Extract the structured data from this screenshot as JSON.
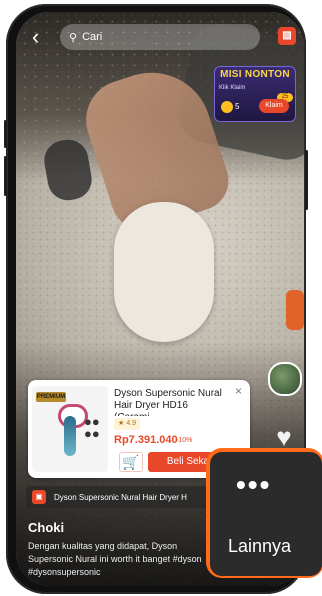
{
  "search": {
    "placeholder": "Cari"
  },
  "mission": {
    "title": "MISI NONTON",
    "subtitle": "Klik Klaim",
    "coins": "5",
    "badge": "25",
    "claim_label": "Klaim"
  },
  "product": {
    "tag": "PREMIUM",
    "name": "Dyson Supersonic Nural Hair Dryer HD16 (Cerami...",
    "rating": "4.9",
    "price": "Rp7.391.040",
    "discount": "-10%",
    "buy_label": "Beli Sekarang"
  },
  "strip": {
    "text": "Dyson Supersonic Nural Hair Dryer H"
  },
  "post": {
    "username": "Choki",
    "description": "Dengan kualitas yang didapat, Dyson Supersonic Nural ini worth it banget #dyson #dysonsupersonic"
  },
  "more_menu": {
    "label": "Lainnya",
    "dots": "•••"
  },
  "icons": {
    "back": "chevron-left-icon",
    "search": "search-icon",
    "cart": "cart-icon",
    "heart": "heart-icon",
    "close": "close-icon",
    "shopping_bag": "shopping-bag-icon",
    "more": "more-dots-icon"
  },
  "colors": {
    "accent": "#e8472a",
    "highlight": "#ff6b1a"
  }
}
